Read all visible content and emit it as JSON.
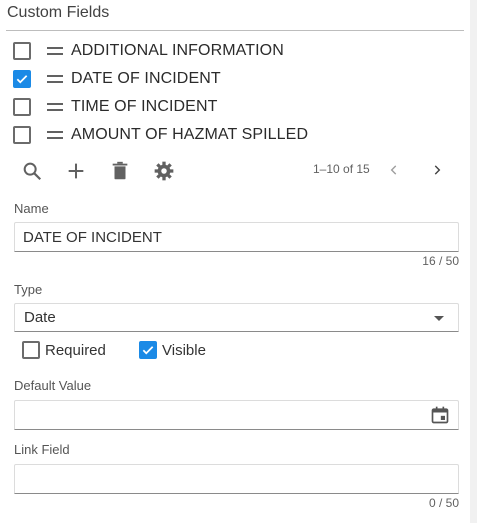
{
  "panel": {
    "title": "Custom Fields"
  },
  "fields": [
    {
      "label": "ADDITIONAL INFORMATION",
      "checked": false
    },
    {
      "label": "DATE OF INCIDENT",
      "checked": true
    },
    {
      "label": "TIME OF INCIDENT",
      "checked": false
    },
    {
      "label": "AMOUNT OF HAZMAT SPILLED",
      "checked": false
    }
  ],
  "toolbar": {
    "icons": [
      "search-icon",
      "add-icon",
      "trash-icon",
      "gear-icon"
    ]
  },
  "pager": {
    "range": "1–10 of 15"
  },
  "form": {
    "name_label": "Name",
    "name_value": "DATE OF INCIDENT",
    "name_counter": "16 / 50",
    "type_label": "Type",
    "type_value": "Date",
    "required_label": "Required",
    "required_checked": false,
    "visible_label": "Visible",
    "visible_checked": true,
    "default_label": "Default Value",
    "default_value": "",
    "link_label": "Link Field",
    "link_value": "",
    "link_counter": "0 / 50"
  },
  "colors": {
    "accent": "#1b8ae6",
    "text": "#212121",
    "muted": "#616161"
  }
}
